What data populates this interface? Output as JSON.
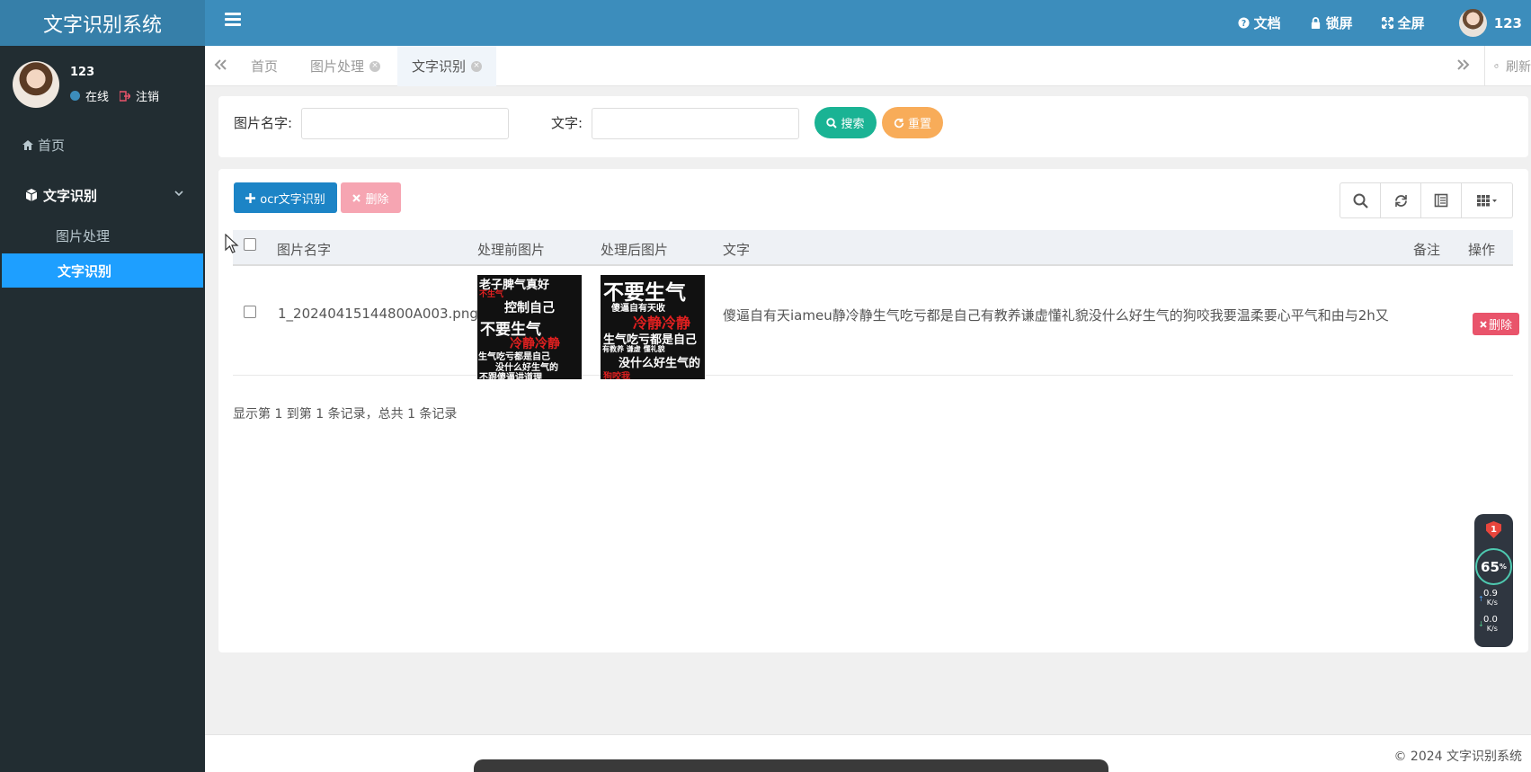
{
  "header": {
    "logo": "文字识别系统",
    "menu": [
      {
        "icon": "question-circle-icon",
        "label": "文档"
      },
      {
        "icon": "lock-icon",
        "label": "锁屏"
      },
      {
        "icon": "fullscreen-icon",
        "label": "全屏"
      }
    ],
    "username": "123"
  },
  "sidebar": {
    "user": {
      "name": "123",
      "status": "在线",
      "logout": "注销"
    },
    "home": "首页",
    "group": "文字识别",
    "items": [
      {
        "label": "图片处理",
        "active": false
      },
      {
        "label": "文字识别",
        "active": true
      }
    ]
  },
  "tabs": {
    "items": [
      {
        "label": "首页",
        "closable": false
      },
      {
        "label": "图片处理",
        "closable": true
      },
      {
        "label": "文字识别",
        "closable": true,
        "active": true
      }
    ],
    "refresh": "刷新"
  },
  "search": {
    "name_label": "图片名字:",
    "name_value": "",
    "text_label": "文字:",
    "text_value": "",
    "search_button": "搜索",
    "reset_button": "重置"
  },
  "toolbar": {
    "add_button": "ocr文字识别",
    "delete_button": "删除"
  },
  "table": {
    "columns": [
      "图片名字",
      "处理前图片",
      "处理后图片",
      "文字",
      "备注",
      "操作"
    ],
    "rows": [
      {
        "name": "1_20240415144800A003.png",
        "text": "傻逼自有天iameu静冷静生气吃亏都是自己有教养谦虚懂礼貌没什么好生气的狗咬我要温柔要心平气和由与2h又",
        "remark": "",
        "action": "删除"
      }
    ],
    "pager": "显示第 1 到第 1 条记录，总共 1 条记录"
  },
  "thumb_before": {
    "lines": [
      "老子脾气真好",
      "不生气",
      "控制自己",
      "不要生气",
      "冷静冷静",
      "生气吃亏都是自己",
      "没什么好生气的",
      "不跟傻逼讲道理"
    ]
  },
  "thumb_after": {
    "lines": [
      "不要生气",
      "傻逼自有天收",
      "冷静冷静",
      "生气吃亏都是自己",
      "有教养 谦虚 懂礼貌",
      "没什么好生气的",
      "狗咬我"
    ]
  },
  "footer": {
    "copyright": "© 2024 文字识别系统"
  },
  "widget": {
    "badge": "1",
    "percent": "65",
    "percent_unit": "%",
    "up": "0.9",
    "up_unit": "K/s",
    "down": "0.0",
    "down_unit": "K/s"
  },
  "colors": {
    "header": "#3c8dbc",
    "sidebar": "#222d32",
    "active_item": "#1e9fff",
    "search_btn": "#1ab394",
    "reset_btn": "#f8ac59",
    "add_btn": "#1c84c6",
    "delete_btn": "#f6a5b2",
    "row_delete": "#e9546b"
  }
}
